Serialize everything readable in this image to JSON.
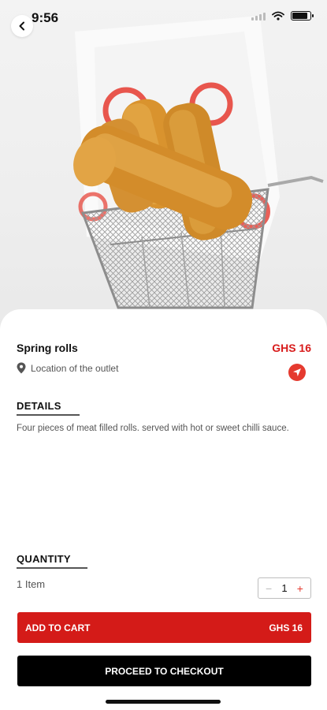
{
  "status_bar": {
    "time": "9:56"
  },
  "product": {
    "name": "Spring rolls",
    "price": "GHS 16",
    "location": "Location of the outlet"
  },
  "details": {
    "heading": "DETAILS",
    "description": "Four pieces of meat filled rolls.  served with hot or sweet chilli sauce."
  },
  "quantity": {
    "heading": "QUANTITY",
    "summary": "1 Item",
    "minus": "−",
    "value": "1",
    "plus": "+"
  },
  "actions": {
    "add_to_cart_label": "ADD TO CART",
    "add_to_cart_price": "GHS 16",
    "checkout_label": "PROCEED TO CHECKOUT"
  },
  "colors": {
    "accent_red": "#d41b18",
    "price_red": "#d81b1b",
    "checkout_black": "#000000"
  },
  "icons": [
    "chevron-left-icon",
    "signal-icon",
    "wifi-icon",
    "battery-icon",
    "location-pin-icon",
    "navigation-arrow-icon"
  ]
}
